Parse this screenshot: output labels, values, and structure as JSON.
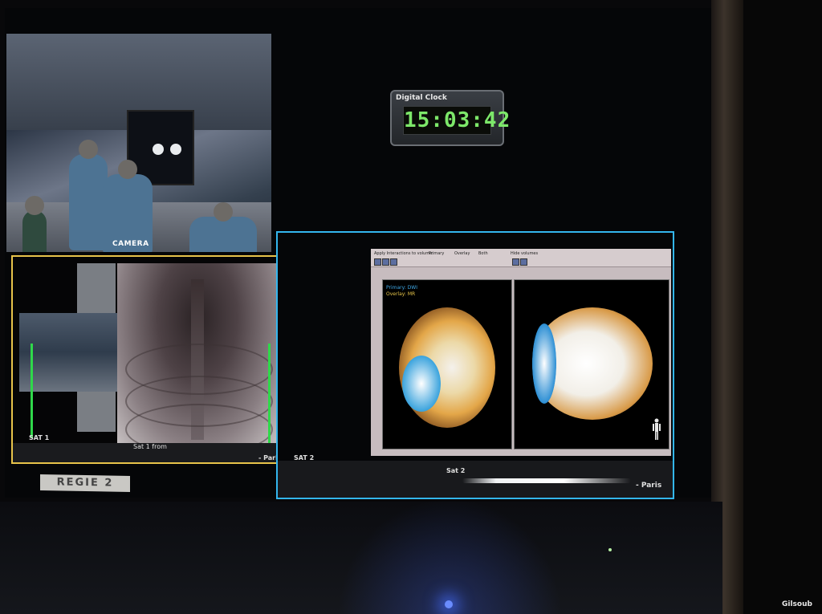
{
  "clock": {
    "title": "Digital Clock",
    "time": "15:03:42"
  },
  "camera": {
    "label": "CAMERA"
  },
  "sat1": {
    "label": "SAT 1",
    "caption": "Sat 1 from",
    "location": "- Paris",
    "border_color": "#e7c34a"
  },
  "sat2": {
    "label": "SAT 2",
    "caption": "Sat 2",
    "location": "- Paris",
    "border_color": "#33b6ee",
    "viewer": {
      "toolbar_title": "Apply Interactions to volume:",
      "option_primary": "Primary",
      "option_overlay": "Overlay",
      "option_both": "Both",
      "hide_volumes": "Hide volumes",
      "volume_primary": "Primary: DWI",
      "volume_overlay": "Overlay: MR"
    }
  },
  "labels": {
    "regie": "REGIE 2",
    "watermark": "Gilsoub"
  },
  "colors": {
    "clock_digits": "#7de86a",
    "vu_meter": "#2fd84a"
  }
}
